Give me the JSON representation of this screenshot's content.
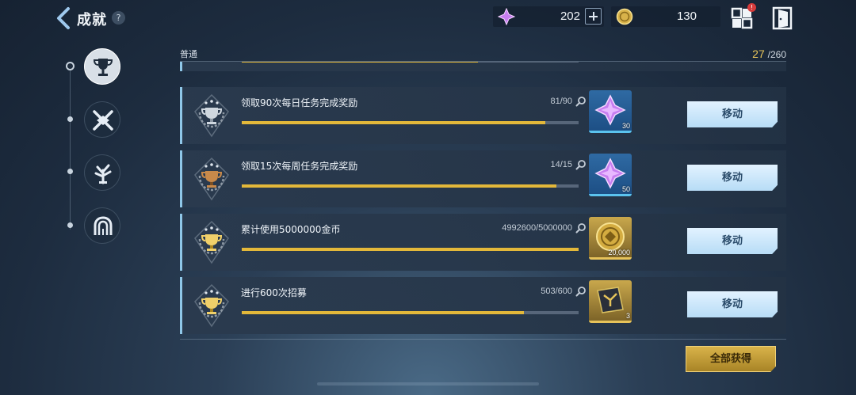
{
  "header": {
    "title": "成就",
    "help": "?",
    "resources": [
      {
        "icon": "purple-crystal-icon",
        "value": "202"
      },
      {
        "icon": "gold-coin-icon",
        "value": "130"
      }
    ],
    "notification_badge": "!"
  },
  "section": {
    "label": "普通",
    "progress_current": "27",
    "progress_total": "/260"
  },
  "achievements": [
    {
      "title": "领取90次每日任务完成奖励",
      "progress_text": "81/90",
      "progress": 0.9,
      "badge": "silver",
      "reward_icon": "purple-crystal-icon",
      "reward_qty": "30",
      "reward_frame": "blue",
      "button": "移动"
    },
    {
      "title": "领取15次每周任务完成奖励",
      "progress_text": "14/15",
      "progress": 0.933,
      "badge": "bronze",
      "reward_icon": "purple-crystal-icon",
      "reward_qty": "50",
      "reward_frame": "blue",
      "button": "移动"
    },
    {
      "title": "累计使用5000000金币",
      "progress_text": "4992600/5000000",
      "progress": 0.9985,
      "badge": "gold",
      "reward_icon": "gold-coin-icon",
      "reward_qty": "20,000",
      "reward_frame": "gold",
      "button": "移动"
    },
    {
      "title": "进行600次招募",
      "progress_text": "503/600",
      "progress": 0.838,
      "badge": "gold",
      "reward_icon": "recruit-ticket-icon",
      "reward_qty": "3",
      "reward_frame": "gold",
      "button": "移动"
    }
  ],
  "footer": {
    "claim_all": "全部获得"
  },
  "colors": {
    "progress_fill": "#e3b83a",
    "accent_blue": "#8fc7e8",
    "gold": "#e6c45a"
  }
}
